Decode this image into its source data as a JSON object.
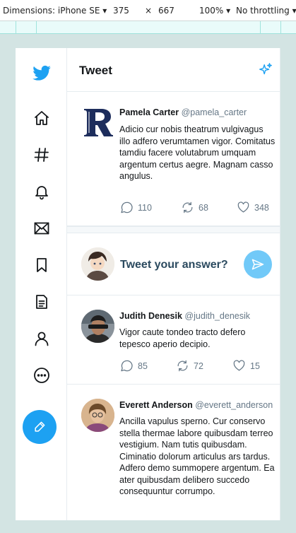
{
  "devtools": {
    "device": "Dimensions: iPhone SE",
    "width": "375",
    "times": "×",
    "height": "667",
    "zoom": "100%",
    "throttle": "No throttling"
  },
  "header": {
    "title": "Tweet"
  },
  "nav": [
    "home-icon",
    "hashtag-icon",
    "bell-icon",
    "mail-icon",
    "bookmark-icon",
    "document-icon",
    "user-icon",
    "more-icon",
    "compose-icon"
  ],
  "colors": {
    "accent": "#1da1f2",
    "send": "#71c9f8",
    "muted": "#657786"
  },
  "main_tweet": {
    "name": "Pamela Carter",
    "handle": "@pamela_carter",
    "text": "Adicio cur nobis theatrum vulgivagus illo adfero verumtamen vigor. Comitatus tamdiu facere volutabrum umquam argentum certus aegre. Magnam casso angulus.",
    "replies": "110",
    "retweets": "68",
    "likes": "348"
  },
  "reply_box": {
    "prompt": "Tweet your answer?"
  },
  "replies": [
    {
      "name": "Judith Denesik",
      "handle": "@judith_denesik",
      "text": "Vigor caute tondeo tracto defero tepesco aperio decipio.",
      "replies": "85",
      "retweets": "72",
      "likes": "15"
    },
    {
      "name": "Everett Anderson",
      "handle": "@everett_anderson",
      "text": "Ancilla vapulus sperno. Cur conservo stella thermae labore quibusdam terreo vestigium. Nam tutis quibusdam. Ciminatio dolorum articulus ars tardus. Adfero demo summopere argentum. Ea ater quibusdam delibero succedo consequuntur corrumpo."
    }
  ]
}
